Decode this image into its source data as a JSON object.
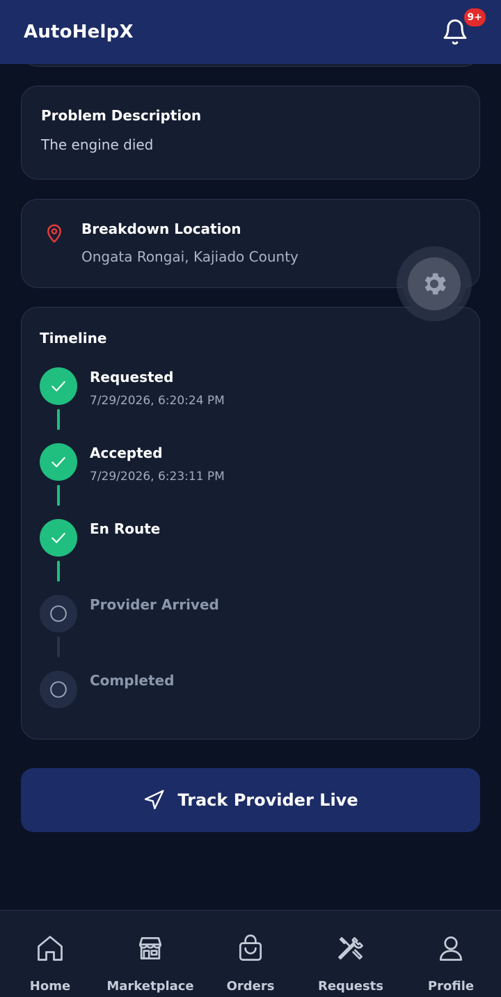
{
  "header": {
    "title": "AutoHelpX",
    "notification_badge": "9+"
  },
  "problem": {
    "title": "Problem Description",
    "text": "The engine died"
  },
  "location": {
    "title": "Breakdown Location",
    "text": "Ongata Rongai, Kajiado County"
  },
  "timeline": {
    "title": "Timeline",
    "steps": [
      {
        "label": "Requested",
        "time": "7/29/2026, 6:20:24 PM",
        "status": "done"
      },
      {
        "label": "Accepted",
        "time": "7/29/2026, 6:23:11 PM",
        "status": "done"
      },
      {
        "label": "En Route",
        "time": "",
        "status": "done"
      },
      {
        "label": "Provider Arrived",
        "time": "",
        "status": "pending"
      },
      {
        "label": "Completed",
        "time": "",
        "status": "pending"
      }
    ]
  },
  "actions": {
    "track_label": "Track Provider Live"
  },
  "nav": {
    "items": [
      {
        "label": "Home",
        "icon": "home-icon"
      },
      {
        "label": "Marketplace",
        "icon": "store-icon"
      },
      {
        "label": "Orders",
        "icon": "bag-icon"
      },
      {
        "label": "Requests",
        "icon": "tools-icon"
      },
      {
        "label": "Profile",
        "icon": "user-icon"
      }
    ]
  },
  "colors": {
    "header": "#1c2c66",
    "background": "#0b1224",
    "success": "#20bf7f",
    "alert": "#e22b2b"
  }
}
